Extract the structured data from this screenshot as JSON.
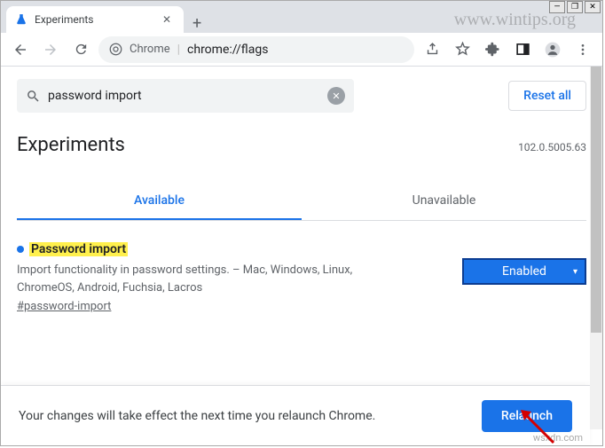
{
  "window": {
    "tab_title": "Experiments"
  },
  "toolbar": {
    "url_scheme": "Chrome",
    "url_path": "chrome://flags"
  },
  "search": {
    "value": "password import",
    "reset_label": "Reset all"
  },
  "page": {
    "title": "Experiments",
    "version": "102.0.5005.63"
  },
  "tabs": {
    "available": "Available",
    "unavailable": "Unavailable"
  },
  "flag": {
    "title": "Password import",
    "description": "Import functionality in password settings. – Mac, Windows, Linux, ChromeOS, Android, Fuchsia, Lacros",
    "anchor": "#password-import",
    "selected": "Enabled"
  },
  "bottom": {
    "message": "Your changes will take effect the next time you relaunch Chrome.",
    "relaunch": "Relaunch"
  },
  "watermark1": "www.wintips.org",
  "watermark2": "wsxdn.com"
}
